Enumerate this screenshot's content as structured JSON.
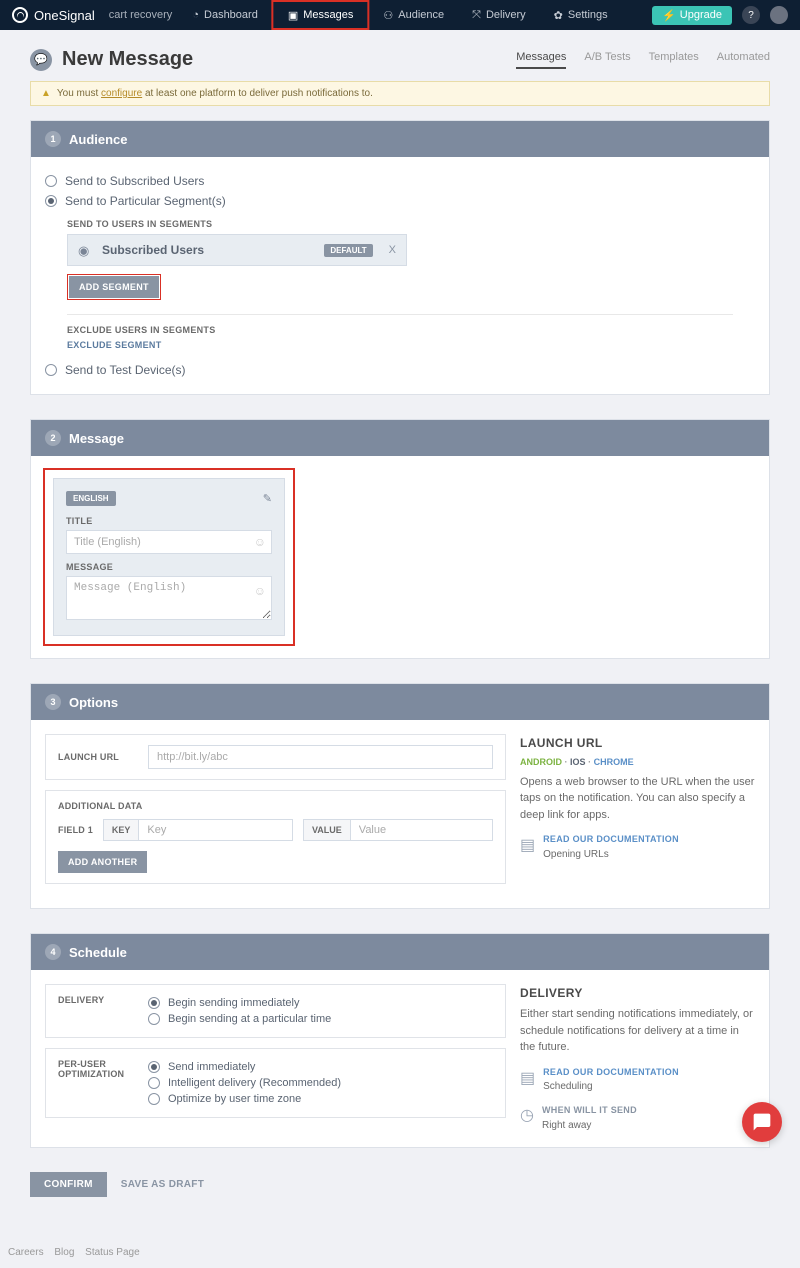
{
  "nav": {
    "brand": "OneSignal",
    "app": "cart recovery",
    "items": [
      "Dashboard",
      "Messages",
      "Audience",
      "Delivery",
      "Settings"
    ],
    "upgrade": "Upgrade"
  },
  "page": {
    "title": "New Message",
    "tabs": [
      "Messages",
      "A/B Tests",
      "Templates",
      "Automated"
    ]
  },
  "warning": {
    "pre": "You must",
    "link": "configure",
    "post": "at least one platform to deliver push notifications to."
  },
  "audience": {
    "title": "Audience",
    "opt1": "Send to Subscribed Users",
    "opt2": "Send to Particular Segment(s)",
    "include_label": "SEND TO USERS IN SEGMENTS",
    "segment_name": "Subscribed Users",
    "default_badge": "DEFAULT",
    "add_segment": "ADD SEGMENT",
    "exclude_label": "EXCLUDE USERS IN SEGMENTS",
    "exclude_link": "EXCLUDE SEGMENT",
    "opt3": "Send to Test Device(s)"
  },
  "message": {
    "title": "Message",
    "lang_badge": "ENGLISH",
    "title_label": "TITLE",
    "title_placeholder": "Title (English)",
    "msg_label": "MESSAGE",
    "msg_placeholder": "Message (English)"
  },
  "options": {
    "title": "Options",
    "launch_label": "LAUNCH URL",
    "launch_placeholder": "http://bit.ly/abc",
    "additional_label": "ADDITIONAL DATA",
    "field1": "FIELD 1",
    "key": "KEY",
    "key_ph": "Key",
    "value": "VALUE",
    "value_ph": "Value",
    "add_another": "ADD ANOTHER",
    "info_title": "LAUNCH URL",
    "platforms": {
      "android": "ANDROID",
      "ios": "IOS",
      "chrome": "CHROME"
    },
    "info_desc": "Opens a web browser to the URL when the user taps on the notification. You can also specify a deep link for apps.",
    "doc_title": "READ OUR DOCUMENTATION",
    "doc_sub": "Opening URLs"
  },
  "schedule": {
    "title": "Schedule",
    "delivery_label": "DELIVERY",
    "d1": "Begin sending immediately",
    "d2": "Begin sending at a particular time",
    "peruser_label": "PER-USER OPTIMIZATION",
    "p1": "Send immediately",
    "p2": "Intelligent delivery (Recommended)",
    "p3": "Optimize by user time zone",
    "info_title": "DELIVERY",
    "info_desc": "Either start sending notifications immediately, or schedule notifications for delivery at a time in the future.",
    "doc_title": "READ OUR DOCUMENTATION",
    "doc_sub": "Scheduling",
    "when_title": "WHEN WILL IT SEND",
    "when_sub": "Right away"
  },
  "footer": {
    "confirm": "CONFIRM",
    "draft": "SAVE AS DRAFT",
    "links": [
      "Careers",
      "Blog",
      "Status Page"
    ]
  }
}
